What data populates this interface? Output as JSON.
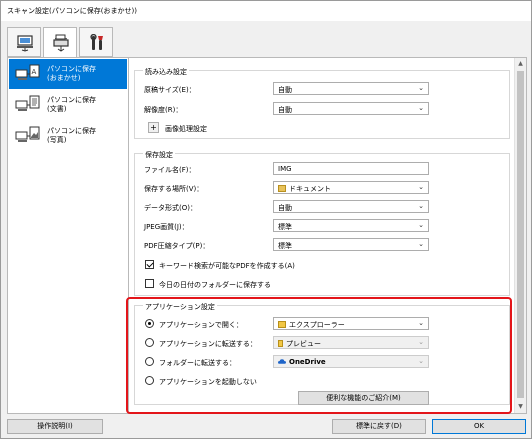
{
  "window": {
    "title": "スキャン設定(パソコンに保存(おまかせ))"
  },
  "tabs": [
    {
      "icon": "scan-from-computer-icon",
      "selected": false
    },
    {
      "icon": "scan-from-panel-icon",
      "selected": true
    },
    {
      "icon": "general-settings-icon",
      "selected": false
    }
  ],
  "leftlist": {
    "items": [
      {
        "line1": "パソコンに保存",
        "line2": "(おまかせ)",
        "icon": "auto-save-icon",
        "selected": true
      },
      {
        "line1": "パソコンに保存",
        "line2": "(文書)",
        "icon": "document-save-icon",
        "selected": false
      },
      {
        "line1": "パソコンに保存",
        "line2": "(写真)",
        "icon": "photo-save-icon",
        "selected": false
      }
    ]
  },
  "scan_settings": {
    "title": "読み込み設定",
    "paper_size_label": "原稿サイズ(E)：",
    "paper_size_value": "自動",
    "resolution_label": "解像度(R)：",
    "resolution_value": "自動",
    "image_processing_label": "画像処理設定"
  },
  "save_settings": {
    "title": "保存設定",
    "file_name_label": "ファイル名(F)：",
    "file_name_value": "IMG",
    "save_in_label": "保存する場所(V)：",
    "save_in_value": "ドキュメント",
    "data_format_label": "データ形式(O)：",
    "data_format_value": "自動",
    "jpeg_quality_label": "JPEG画質(J)：",
    "jpeg_quality_value": "標準",
    "pdf_compression_label": "PDF圧縮タイプ(P)：",
    "pdf_compression_value": "標準",
    "keyword_pdf_label": "キーワード検索が可能なPDFを作成する(A)",
    "keyword_pdf_checked": true,
    "date_folder_label": "今日の日付のフォルダーに保存する",
    "date_folder_checked": false
  },
  "app_settings": {
    "title": "アプリケーション設定",
    "open_app_label": "アプリケーションで開く：",
    "open_app_value": "エクスプローラー",
    "send_app_label": "アプリケーションに転送する：",
    "send_app_value": "プレビュー",
    "send_folder_label": "フォルダーに転送する：",
    "send_folder_value": "OneDrive",
    "no_app_label": "アプリケーションを起動しない",
    "selected_option": "open_app",
    "features_button": "便利な機能のご紹介(M)"
  },
  "footer": {
    "instructions_button": "操作説明(I)",
    "defaults_button": "標準に戻す(D)",
    "ok_button": "OK"
  },
  "colors": {
    "accent": "#0078d7",
    "highlight_border": "#e3151a"
  }
}
